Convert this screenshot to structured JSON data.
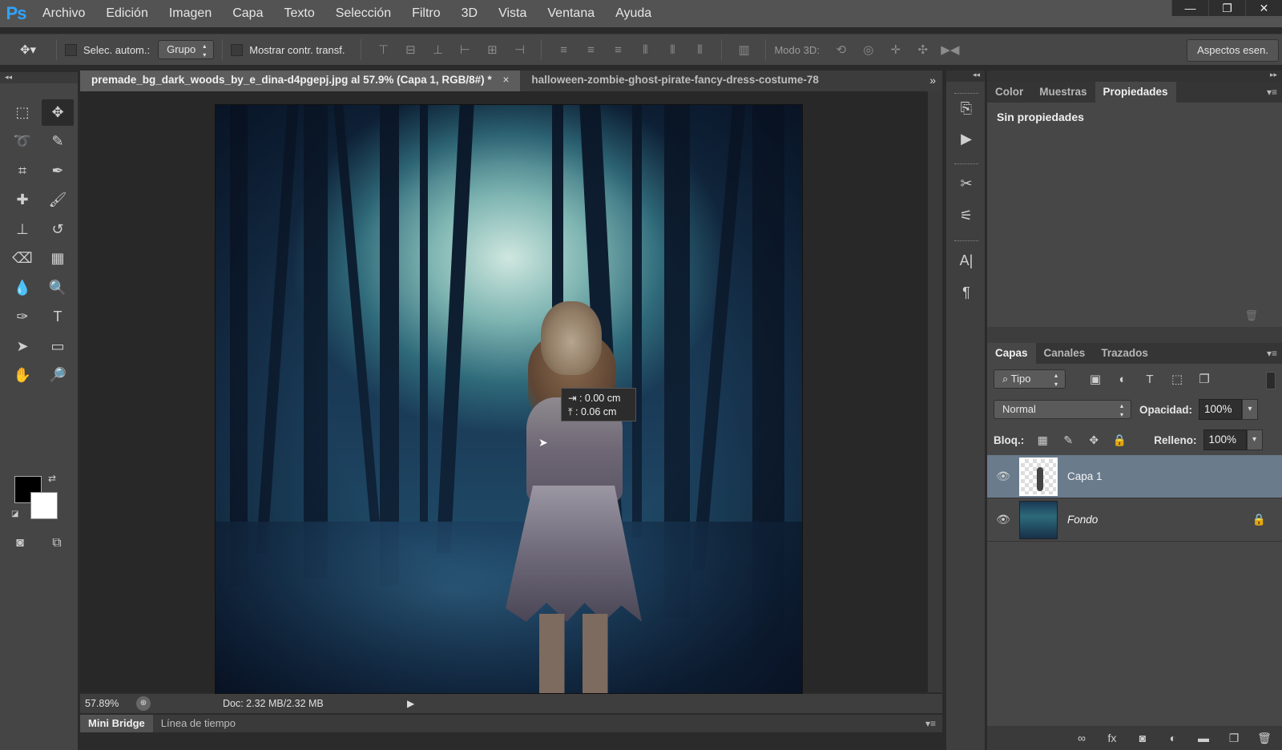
{
  "app": {
    "logo": "Ps"
  },
  "menu": [
    "Archivo",
    "Edición",
    "Imagen",
    "Capa",
    "Texto",
    "Selección",
    "Filtro",
    "3D",
    "Vista",
    "Ventana",
    "Ayuda"
  ],
  "window_controls": {
    "minimize": "—",
    "maximize": "❐",
    "close": "✕"
  },
  "options": {
    "auto_select_label": "Selec. autom.:",
    "auto_select_value": "Grupo",
    "show_transform_label": "Mostrar contr. transf.",
    "mode3d_label": "Modo 3D:",
    "essentials": "Aspectos esen."
  },
  "documents": {
    "active_tab": "premade_bg_dark_woods_by_e_dina-d4pgepj.jpg al 57.9% (Capa 1, RGB/8#) *",
    "close": "×",
    "inactive_tab": "halloween-zombie-ghost-pirate-fancy-dress-costume-78",
    "overflow": "»"
  },
  "canvas": {
    "measure_x": "⇥ :  0.00 cm",
    "measure_y": "⤒ :  0.06 cm"
  },
  "status": {
    "zoom": "57.89%",
    "doc": "Doc: 2.32 MB/2.32 MB",
    "arrow": "▶"
  },
  "bottom_tabs": {
    "active": "Mini Bridge",
    "inactive": "Línea de tiempo"
  },
  "panels": {
    "top_tabs": [
      "Color",
      "Muestras",
      "Propiedades"
    ],
    "active_top_tab": "Propiedades",
    "properties_title": "Sin propiedades",
    "layer_tabs": [
      "Capas",
      "Canales",
      "Trazados"
    ],
    "filter_value": "⌕ Tipo",
    "blend_mode": "Normal",
    "opacity_label": "Opacidad:",
    "opacity_value": "100%",
    "lock_label": "Bloq.:",
    "fill_label": "Relleno:",
    "fill_value": "100%",
    "layers": [
      {
        "name": "Capa 1",
        "selected": true
      },
      {
        "name": "Fondo",
        "selected": false
      }
    ]
  }
}
